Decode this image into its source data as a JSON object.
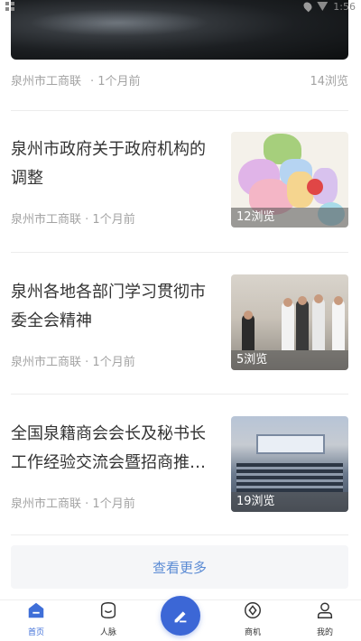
{
  "status": {
    "time": "1:56"
  },
  "top_item": {
    "source": "泉州市工商联",
    "time": "· 1个月前",
    "views": "14浏览"
  },
  "articles": [
    {
      "title": "泉州市政府关于政府机构的调整",
      "source": "泉州市工商联",
      "time": "· 1个月前",
      "views": "12浏览",
      "thumb": "map-image"
    },
    {
      "title": "泉州各地各部门学习贯彻市委全会精神",
      "source": "泉州市工商联",
      "time": "· 1个月前",
      "views": "5浏览",
      "thumb": "meeting-image"
    },
    {
      "title": "全国泉籍商会会长及秘书长工作经验交流会暨招商推介会...",
      "source": "泉州市工商联",
      "time": "· 1个月前",
      "views": "19浏览",
      "thumb": "conference-image"
    }
  ],
  "more_button": "查看更多",
  "tabbar": {
    "items": [
      {
        "label": "首页",
        "icon": "home-icon",
        "active": true
      },
      {
        "label": "人脉",
        "icon": "contacts-icon",
        "active": false
      },
      {
        "label": "",
        "icon": "pen-icon",
        "active": false
      },
      {
        "label": "商机",
        "icon": "business-icon",
        "active": false
      },
      {
        "label": "我的",
        "icon": "profile-icon",
        "active": false
      }
    ]
  },
  "colors": {
    "accent": "#3c67d6",
    "link": "#5b8bd4",
    "muted": "#a3a3a3"
  }
}
